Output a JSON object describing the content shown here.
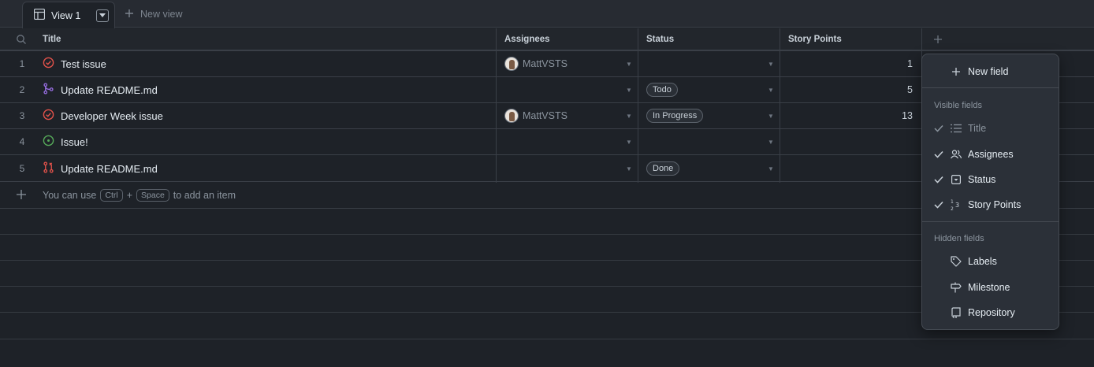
{
  "tabs": {
    "active_label": "View 1",
    "new_view_label": "New view"
  },
  "columns": {
    "title": "Title",
    "assignees": "Assignees",
    "status": "Status",
    "story_points": "Story Points"
  },
  "rows": [
    {
      "num": "1",
      "title": "Test issue",
      "icon": "issue-closed-icon",
      "assignee": "MattVSTS",
      "status": "",
      "points": "1"
    },
    {
      "num": "2",
      "title": "Update README.md",
      "icon": "pull-request-merged-icon",
      "assignee": "",
      "status": "Todo",
      "points": "5"
    },
    {
      "num": "3",
      "title": "Developer Week issue",
      "icon": "issue-closed-icon",
      "assignee": "MattVSTS",
      "status": "In Progress",
      "points": "13"
    },
    {
      "num": "4",
      "title": "Issue!",
      "icon": "issue-open-icon",
      "assignee": "",
      "status": "",
      "points": ""
    },
    {
      "num": "5",
      "title": "Update README.md",
      "icon": "pull-request-closed-icon",
      "assignee": "",
      "status": "Done",
      "points": ""
    }
  ],
  "add_item": {
    "prefix": "You can use",
    "key1": "Ctrl",
    "plus": "+",
    "key2": "Space",
    "suffix": "to add an item"
  },
  "menu": {
    "new_field": "New field",
    "visible_heading": "Visible fields",
    "visible": [
      {
        "label": "Title",
        "icon": "list-icon",
        "checked": true,
        "dim": true
      },
      {
        "label": "Assignees",
        "icon": "people-icon",
        "checked": true,
        "dim": false
      },
      {
        "label": "Status",
        "icon": "single-select-icon",
        "checked": true,
        "dim": false
      },
      {
        "label": "Story Points",
        "icon": "number-icon",
        "checked": true,
        "dim": false
      }
    ],
    "hidden_heading": "Hidden fields",
    "hidden": [
      {
        "label": "Labels",
        "icon": "tag-icon"
      },
      {
        "label": "Milestone",
        "icon": "milestone-icon"
      },
      {
        "label": "Repository",
        "icon": "repo-icon"
      }
    ]
  },
  "colors": {
    "closed_issue": "#e5534b",
    "open_issue": "#57ab5a",
    "merged_pr": "#986ee2",
    "closed_pr": "#e5534b"
  }
}
